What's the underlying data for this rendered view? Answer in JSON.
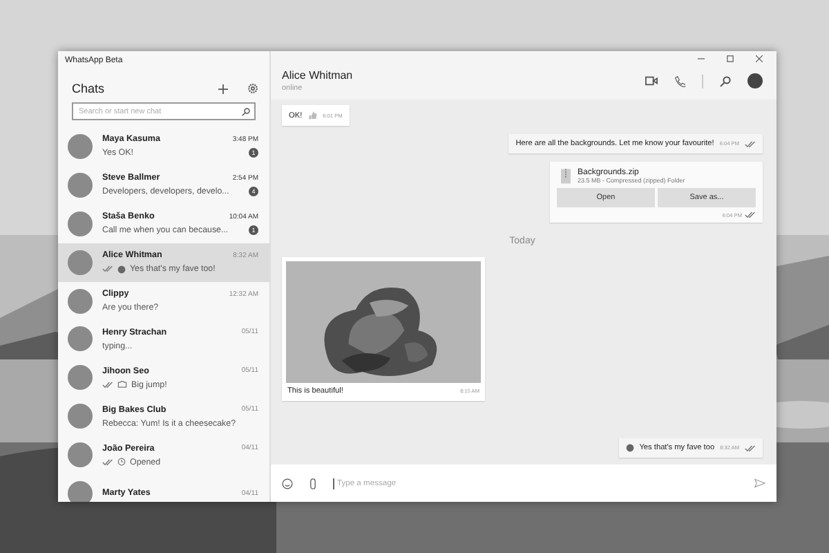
{
  "window": {
    "title": "WhatsApp Beta"
  },
  "sidebar": {
    "heading": "Chats",
    "search": {
      "placeholder": "Search or start new chat"
    },
    "chats": [
      {
        "kind": "text",
        "name": "Maya Kasuma",
        "time": "3:48 PM",
        "preview": "Yes OK!",
        "sent": false,
        "unread": "1",
        "selected": false
      },
      {
        "kind": "text",
        "name": "Steve Ballmer",
        "time": "2:54 PM",
        "preview": "Developers, developers, develo...",
        "sent": false,
        "unread": "4",
        "selected": false
      },
      {
        "kind": "text",
        "name": "Staša Benko",
        "time": "10:04 AM",
        "preview": "Call me when you can because...",
        "sent": false,
        "unread": "1",
        "selected": false
      },
      {
        "kind": "emoji",
        "name": "Alice Whitman",
        "time": "8:32 AM",
        "preview": "Yes that's my fave too!",
        "sent": true,
        "selected": true
      },
      {
        "kind": "text",
        "name": "Clippy",
        "time": "12:32 AM",
        "preview": "Are you there?",
        "sent": false,
        "selected": false
      },
      {
        "kind": "text",
        "name": "Henry Strachan",
        "time": "05/11",
        "preview": "typing...",
        "sent": false,
        "selected": false
      },
      {
        "name": "Jihoon Seo",
        "time": "05/11",
        "preview": "Big jump!",
        "sent": true,
        "selected": false
      },
      {
        "kind": "text",
        "name": "Big Bakes Club",
        "time": "05/11",
        "preview": "Rebecca: Yum! Is it a cheesecake?",
        "sent": false,
        "selected": false
      },
      {
        "kind": "viewonce",
        "name": "João Pereira",
        "time": "04/11",
        "preview": "Opened",
        "sent": true,
        "selected": false
      },
      {
        "name": "Marty Yates",
        "time": "04/11",
        "selected": false
      }
    ]
  },
  "conversation": {
    "name": "Alice Whitman",
    "status": "online",
    "messages": [
      {
        "kind": "received",
        "text": "OK!",
        "thumb": true,
        "time": "6:01 PM"
      },
      {
        "kind": "sent",
        "text": "Here are all the backgrounds. Let me know your favourite!",
        "time": "6:04 PM"
      },
      {
        "kind": "file",
        "file": "Backgrounds.zip",
        "details": "23.5 MB - Compressed (zipped) Folder",
        "buttons": [
          "Open",
          "Save as..."
        ],
        "time": "6:04 PM"
      },
      {
        "kind": "date",
        "text": "Today"
      },
      {
        "text": "This is beautiful!",
        "time": "8:15 AM"
      },
      {
        "kind": "sent",
        "text": "Yes that's my fave too",
        "emoji": true,
        "time": "8:32 AM"
      }
    ]
  },
  "composer": {
    "placeholder": "Type a message"
  }
}
